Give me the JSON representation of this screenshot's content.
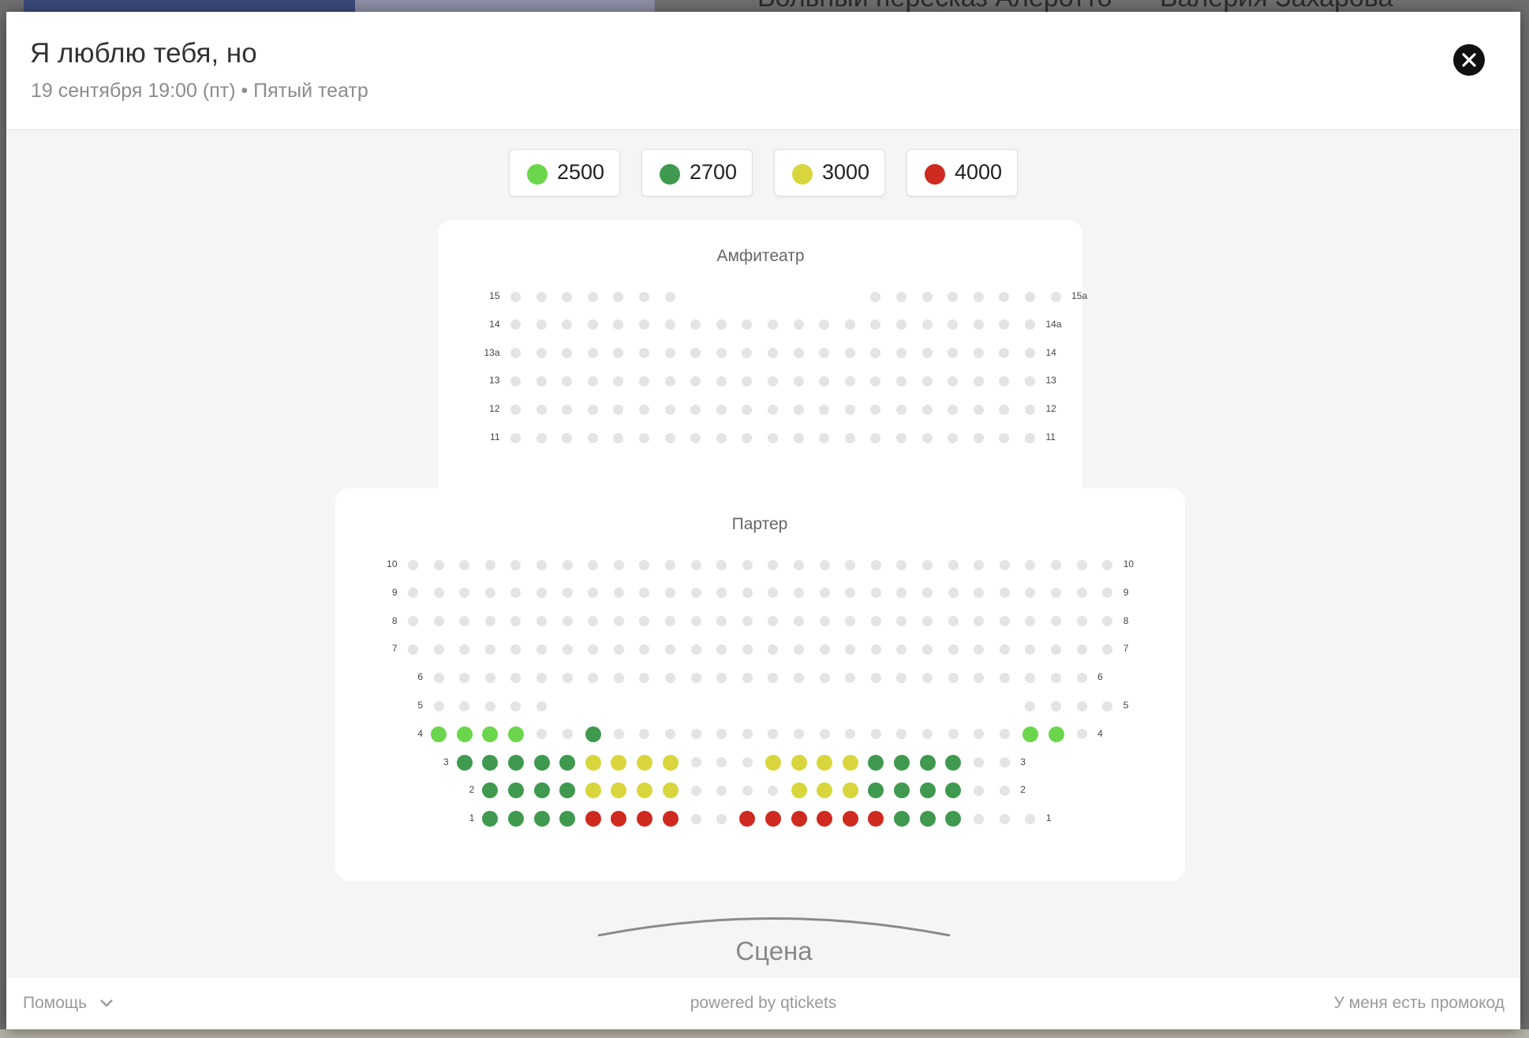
{
  "background_page": {
    "left_text": "Вольный пересказ Алеротто",
    "right_text": "Валерия Захарова"
  },
  "modal": {
    "title": "Я люблю тебя, но",
    "subtitle": "19 сентября 19:00 (пт) • Пятый театр",
    "close_icon": "close-icon"
  },
  "price_legend": [
    {
      "label": "2500",
      "color": "#6bd64b"
    },
    {
      "label": "2700",
      "color": "#3f9a4f"
    },
    {
      "label": "3000",
      "color": "#d8d63c"
    },
    {
      "label": "4000",
      "color": "#cf2a20"
    }
  ],
  "seat_colors": {
    "unavailable": "#e4e4e4",
    "2500": "#6bd64b",
    "2700": "#3f9a4f",
    "3000": "#d8d63c",
    "4000": "#cf2a20"
  },
  "sections": [
    {
      "name": "Амфитеатр",
      "rows": [
        {
          "left_label": "15",
          "right_label": "15а",
          "start": 0,
          "seats": "xxxxxxx.......xxxxxxxx"
        },
        {
          "left_label": "14",
          "right_label": "14а",
          "start": 0,
          "seats": "xxxxxxxxxxxxxxxxxxxxx"
        },
        {
          "left_label": "13а",
          "right_label": "14",
          "start": 0,
          "seats": "xxxxxxxxxxxxxxxxxxxxx"
        },
        {
          "left_label": "13",
          "right_label": "13",
          "start": 0,
          "seats": "xxxxxxxxxxxxxxxxxxxxx"
        },
        {
          "left_label": "12",
          "right_label": "12",
          "start": 0,
          "seats": "xxxxxxxxxxxxxxxxxxxxx"
        },
        {
          "left_label": "11",
          "right_label": "11",
          "start": 0,
          "seats": "xxxxxxxxxxxxxxxxxxxxx"
        }
      ]
    },
    {
      "name": "Партер",
      "rows": [
        {
          "left_label": "10",
          "right_label": "10",
          "start": 0,
          "seats": "xxxxxxxxxxxxxxxxxxxxxxxxxxxx"
        },
        {
          "left_label": "9",
          "right_label": "9",
          "start": 0,
          "seats": "xxxxxxxxxxxxxxxxxxxxxxxxxxxx"
        },
        {
          "left_label": "8",
          "right_label": "8",
          "start": 0,
          "seats": "xxxxxxxxxxxxxxxxxxxxxxxxxxxx"
        },
        {
          "left_label": "7",
          "right_label": "7",
          "start": 0,
          "seats": "xxxxxxxxxxxxxxxxxxxxxxxxxxxx"
        },
        {
          "left_label": "6",
          "right_label": "6",
          "start": 1,
          "seats": "xxxxxxxxxxxxxxxxxxxxxxxxxx"
        },
        {
          "left_label": "5",
          "right_label": "5",
          "start": 1,
          "seats": "xxxxx..................xxxx"
        },
        {
          "left_label": "4",
          "right_label": "4",
          "start": 1,
          "seats": "aaaaxxbxxxxxxxxxxxxxxxxaax"
        },
        {
          "left_label": "3",
          "right_label": "3",
          "start": 2,
          "seats": "bbbbbccccxxxccccbbbbxx"
        },
        {
          "left_label": "2",
          "right_label": "2",
          "start": 3,
          "seats": "bbbbccccxxxxcccbbbbxx"
        },
        {
          "left_label": "1",
          "right_label": "1",
          "start": 3,
          "seats": "bbbbddddxxddddddbbbxxx"
        }
      ]
    }
  ],
  "stage": {
    "label": "Сцена"
  },
  "footer": {
    "help": "Помощь",
    "powered": "powered by qtickets",
    "promo": "У меня есть промокод"
  }
}
